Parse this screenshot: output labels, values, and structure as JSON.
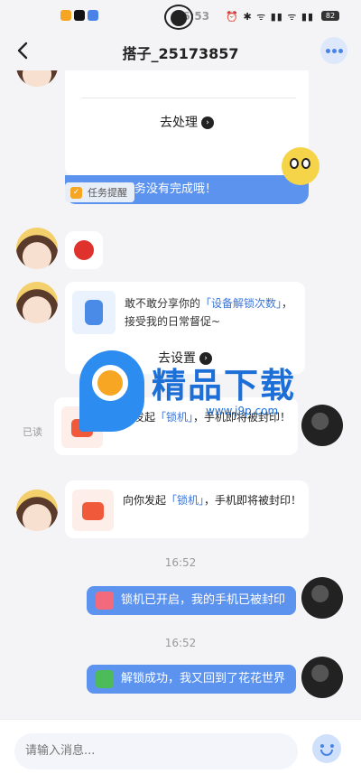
{
  "status_bar": {
    "time": "16:53",
    "system": "⏰ ✱ ᯤ ▮▮ ᯤ ▮▮",
    "battery": "82"
  },
  "header": {
    "title": "搭子_25173857"
  },
  "messages": {
    "task_card": {
      "action": "去处理",
      "banner": "今天还有任务没有完成哦！",
      "reminder": "任务提醒"
    },
    "share_card": {
      "text_a": "敢不敢分享你的",
      "highlight": "「设备解锁次数」",
      "text_b": "，接受我的日常督促~",
      "action": "去设置"
    },
    "read_status": "已读",
    "lock_sent": {
      "text_a": "向你发起",
      "highlight": "「锁机」",
      "text_b": "，手机即将被封印！"
    },
    "lock_received": {
      "text_a": "向你发起",
      "highlight": "「锁机」",
      "text_b": "，手机即将被封印！"
    },
    "time_1": "16:52",
    "status_locked": "锁机已开启，我的手机已被封印",
    "time_2": "16:52",
    "status_unlocked": "解锁成功，我又回到了花花世界"
  },
  "watermark": {
    "brand": "精品下载",
    "url": "www.j9p.com"
  },
  "composer": {
    "placeholder": "请输入消息..."
  }
}
